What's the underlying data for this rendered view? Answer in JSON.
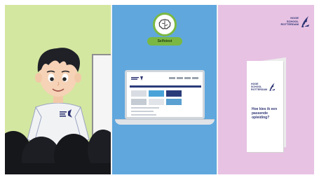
{
  "colors": {
    "left_panel_bg": "#d4e7a0",
    "middle_panel_bg": "#5fa7dd",
    "right_panel_bg": "#e7c2e3",
    "accent_green": "#7bb843",
    "brand_navy": "#2d3473"
  },
  "middle_panel": {
    "badge_icon": "brain-icon",
    "badge_label": "Selfstest"
  },
  "right_panel": {
    "logo_lines": [
      "HOGE",
      "SCHOOL",
      "ROTTERDAM"
    ],
    "brochure_logo_lines": [
      "HOGE",
      "SCHOOL",
      "ROTTERDAM"
    ],
    "brochure_question": "Hoe kies ik een passende opleiding?"
  }
}
